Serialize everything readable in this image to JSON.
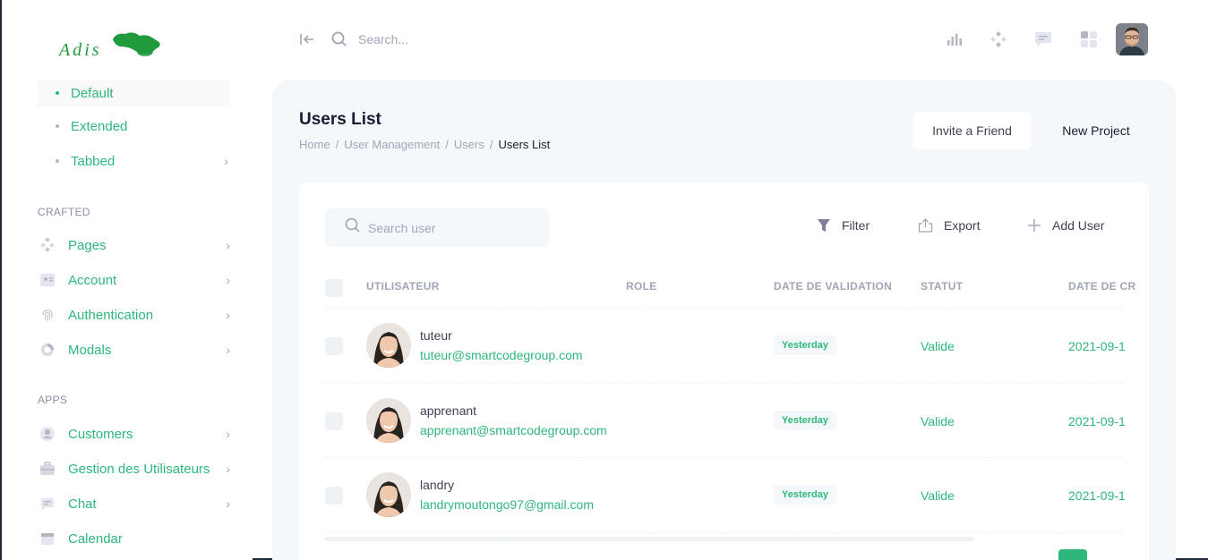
{
  "brand": {
    "logo_text": "Adis",
    "accent": "#2fb67c"
  },
  "sidebar": {
    "sub_items": [
      {
        "label": "Default",
        "active": true
      },
      {
        "label": "Extended",
        "active": false
      },
      {
        "label": "Tabbed",
        "active": false,
        "has_chevron": true
      }
    ],
    "sections": [
      {
        "title": "CRAFTED",
        "items": [
          {
            "label": "Pages",
            "icon": "pages-icon"
          },
          {
            "label": "Account",
            "icon": "account-icon"
          },
          {
            "label": "Authentication",
            "icon": "fingerprint-icon"
          },
          {
            "label": "Modals",
            "icon": "modals-icon"
          }
        ]
      },
      {
        "title": "APPS",
        "items": [
          {
            "label": "Customers",
            "icon": "customers-icon"
          },
          {
            "label": "Gestion des Utilisateurs",
            "icon": "briefcase-icon"
          },
          {
            "label": "Chat",
            "icon": "chat-icon"
          },
          {
            "label": "Calendar",
            "icon": "calendar-icon"
          }
        ]
      }
    ]
  },
  "topbar": {
    "search_placeholder": "Search...",
    "icons": [
      "chart-icon",
      "apps-diamond-icon",
      "message-icon",
      "grid-icon"
    ]
  },
  "page": {
    "title": "Users List",
    "breadcrumb": [
      "Home",
      "User Management",
      "Users",
      "Users List"
    ],
    "invite_label": "Invite a Friend",
    "new_project_label": "New Project"
  },
  "card": {
    "search_placeholder": "Search user",
    "filter_label": "Filter",
    "export_label": "Export",
    "add_user_label": "Add User",
    "columns": [
      "UTILISATEUR",
      "ROLE",
      "DATE DE VALIDATION",
      "STATUT",
      "DATE DE CR"
    ],
    "rows": [
      {
        "name": "tuteur",
        "email": "tuteur@smartcodegroup.com",
        "validation": "Yesterday",
        "status": "Valide",
        "created": "2021-09-1"
      },
      {
        "name": "apprenant",
        "email": "apprenant@smartcodegroup.com",
        "validation": "Yesterday",
        "status": "Valide",
        "created": "2021-09-1"
      },
      {
        "name": "landry",
        "email": "landrymoutongo97@gmail.com",
        "validation": "Yesterday",
        "status": "Valide",
        "created": "2021-09-1"
      }
    ]
  }
}
